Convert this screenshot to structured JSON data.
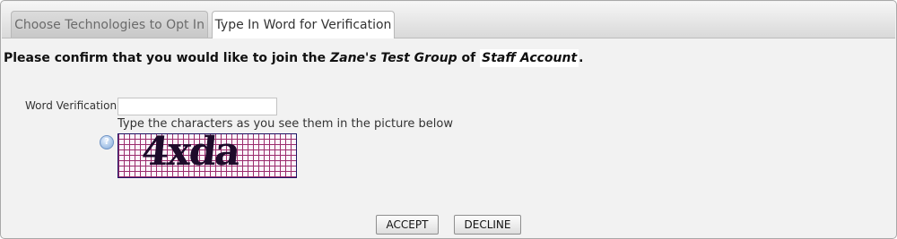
{
  "tabs": [
    {
      "label": "Choose Technologies to Opt In",
      "active": false
    },
    {
      "label": "Type In Word for Verification",
      "active": true
    }
  ],
  "confirmation": {
    "prefix": "Please confirm that you would like to join the ",
    "group": "Zane's Test Group",
    "middle": " of ",
    "account": "Staff Account",
    "suffix": "."
  },
  "verification": {
    "label": "Word Verification",
    "value": "",
    "hint": "Type the characters as you see them in the picture below",
    "help_icon": "question-circle-icon",
    "captcha_text": "4xda"
  },
  "buttons": {
    "accept": "ACCEPT",
    "decline": "DECLINE"
  },
  "colors": {
    "captcha_grid": "#9b2c6d",
    "captcha_border": "#1b1464"
  }
}
